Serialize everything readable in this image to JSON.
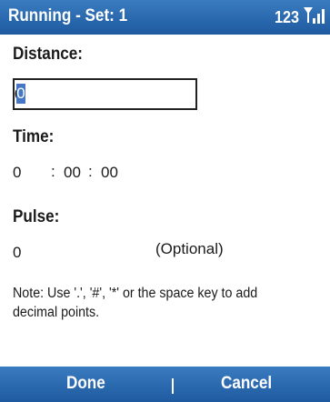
{
  "title_bar": {
    "title": "Running - Set: 1",
    "status_number": "123",
    "signal_icon": "signal-strength-icon"
  },
  "distance": {
    "label": "Distance:",
    "value": "0"
  },
  "time": {
    "label": "Time:",
    "hours": "0",
    "sep1": ":",
    "minutes": "00",
    "sep2": ":",
    "seconds": "00"
  },
  "pulse": {
    "label": "Pulse:",
    "value": "0",
    "hint": "(Optional)"
  },
  "note": "Note: Use '.', '#', '*' or the space key to add decimal points.",
  "softkeys": {
    "left": "Done",
    "right": "Cancel"
  },
  "colors": {
    "bar": "#2b6cb0",
    "selection": "#4677c4"
  }
}
